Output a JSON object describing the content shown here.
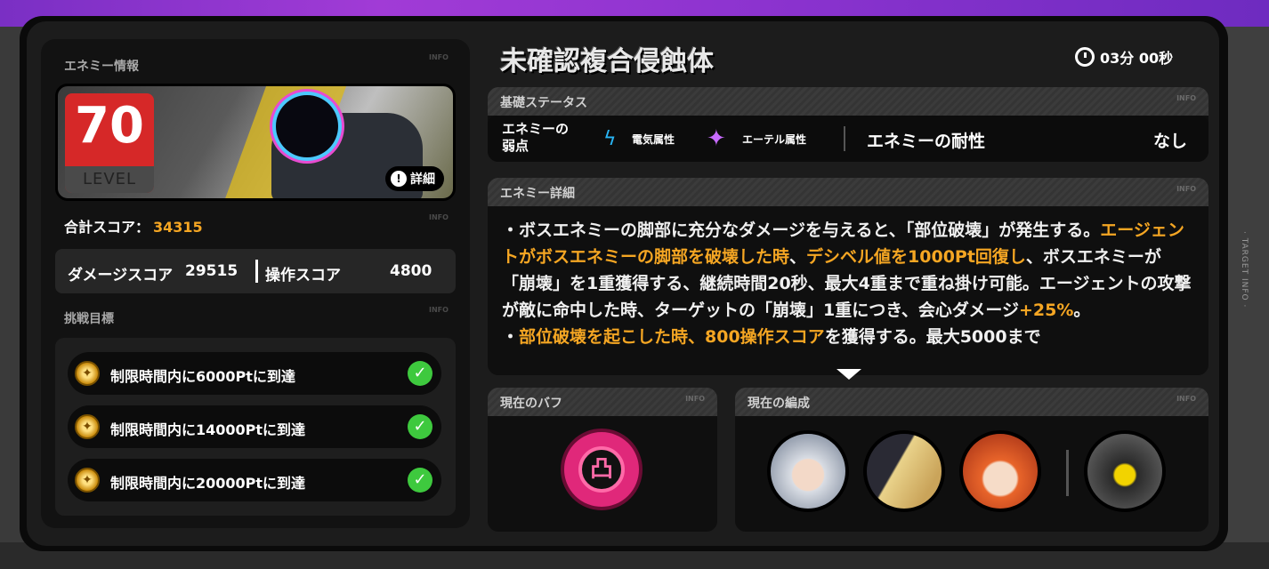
{
  "side": {
    "target_info": "· TARGET INFO ·"
  },
  "enemy": {
    "section_label": "エネミー情報",
    "info_tag": "INFO",
    "level": "70",
    "level_label": "LEVEL",
    "detail_button": "詳細",
    "name": "未確認複合侵蝕体",
    "timer": "03分 00秒"
  },
  "score": {
    "total_label": "合計スコア：",
    "total_value": "34315",
    "damage_label": "ダメージスコア",
    "damage_value": "29515",
    "operation_label": "操作スコア",
    "operation_value": "4800"
  },
  "challenge": {
    "label": "挑戦目標",
    "goals": [
      {
        "text": "制限時間内に6000Ptに到達",
        "completed": true
      },
      {
        "text": "制限時間内に14000Ptに到達",
        "completed": true
      },
      {
        "text": "制限時間内に20000Ptに到達",
        "completed": true
      }
    ]
  },
  "basic_status": {
    "label": "基礎ステータス",
    "weakness_label_1": "エネミーの",
    "weakness_label_2": "弱点",
    "weaknesses": [
      {
        "name": "電気属性",
        "icon": "electric-icon",
        "color": "#29b6f6"
      },
      {
        "name": "エーテル属性",
        "icon": "ether-icon",
        "color": "#c86bff"
      }
    ],
    "resistance_label": "エネミーの耐性",
    "resistance_value": "なし"
  },
  "enemy_detail": {
    "label": "エネミー詳細",
    "p1_a": "・ボスエネミーの脚部に充分なダメージを与えると、「部位破壊」が発生する。",
    "p1_hl1": "エージェントがボスエネミーの脚部を破壊した時",
    "p1_b": "、",
    "p1_hl2": "デシベル値を1000Pt回復し",
    "p1_c": "、ボスエネミーが「崩壊」を1重獲得する、継続時間20秒、最大4重まで重ね掛け可能。エージェントの攻撃が敵に命中した時、ターゲットの「崩壊」1重につき、会心ダメージ",
    "p1_hl3": "+25%",
    "p1_d": "。",
    "p2_a": "・",
    "p2_hl1": "部位破壊を起こした時、800操作スコア",
    "p2_b": "を獲得する。最大5000まで"
  },
  "buff": {
    "label": "現在のバフ",
    "icon": "fist-buff-icon",
    "color": "#e0287a"
  },
  "party": {
    "label": "現在の編成",
    "members": [
      "silver-hair-agent",
      "helmet-blonde-agent",
      "orange-hair-agent"
    ],
    "bangboo": "bangboo"
  },
  "colors": {
    "accent": "#f5a623",
    "level_red": "#d62828",
    "check_green": "#3ec93e",
    "bg_purple": "#8c33cf"
  }
}
